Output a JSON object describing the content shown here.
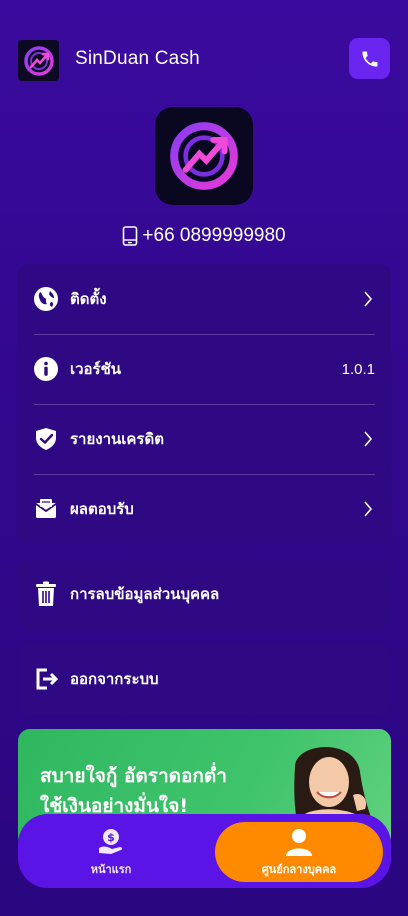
{
  "header": {
    "app_name": "SinDuan Cash"
  },
  "profile": {
    "phone": "+66 0899999980"
  },
  "menu": [
    {
      "label": "ติดตั้ง",
      "value": "",
      "icon": "globe-icon"
    },
    {
      "label": "เวอร์ชัน",
      "value": "1.0.1",
      "icon": "info-icon"
    },
    {
      "label": "รายงานเครดิต",
      "value": "",
      "icon": "shield-check-icon"
    },
    {
      "label": "ผลตอบรับ",
      "value": "",
      "icon": "envelope-icon"
    }
  ],
  "actions": {
    "delete_label": "การลบข้อมูลส่วนบุคคล",
    "logout_label": "ออกจากระบบ"
  },
  "banner": {
    "line1": "สบายใจกู้ อัตราดอกต่ำ",
    "line2": "ใช้เงินอย่างมั่นใจ!"
  },
  "nav": {
    "home_label": "หน้าแรก",
    "center_label": "ศูนย์กลางบุคคล"
  },
  "colors": {
    "background": "#33088f",
    "card": "#2f0883",
    "accent": "#6a26f0",
    "nav_active": "#ff8a00",
    "banner": "#3fc46b"
  }
}
